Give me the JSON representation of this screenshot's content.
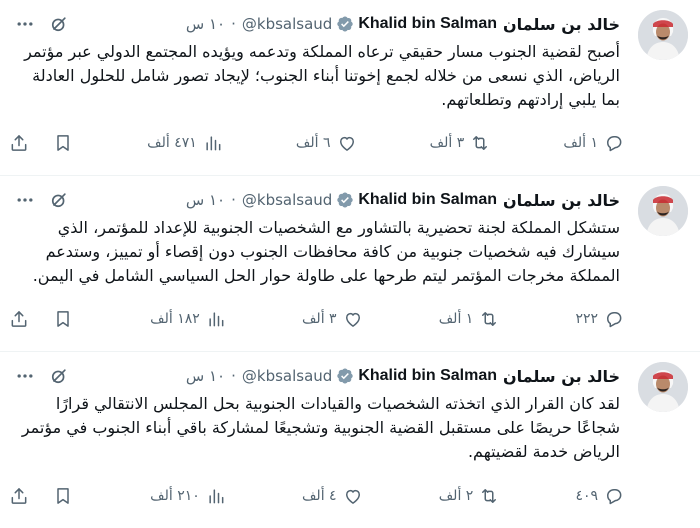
{
  "colors": {
    "text": "#0f1419",
    "muted": "#536471",
    "verified": "#829aab",
    "divider": "#eff3f4"
  },
  "icons": {
    "verified": "verified-badge-icon",
    "more": "more-options-icon",
    "grok": "grok-icon",
    "reply": "reply-icon",
    "repost": "repost-icon",
    "like": "like-icon",
    "views": "views-icon",
    "bookmark": "bookmark-icon",
    "share": "share-icon"
  },
  "tweets": [
    {
      "name_ar": "خالد بن سلمان",
      "name_en": "Khalid bin Salman",
      "handle": "@kbsalsaud",
      "dot": "·",
      "time": "١٠ س",
      "text": "أصبح لقضية الجنوب مسار حقيقي ترعاه المملكة وتدعمه ويؤيده المجتمع الدولي عبر مؤتمر الرياض، الذي نسعى من خلاله لجمع إخوتنا أبناء الجنوب؛ لإيجاد تصور شامل للحلول العادلة بما يلبي إرادتهم وتطلعاتهم.",
      "replies": "١ ألف",
      "reposts": "٣ ألف",
      "likes": "٦ ألف",
      "views": "٤٧١ ألف"
    },
    {
      "name_ar": "خالد بن سلمان",
      "name_en": "Khalid bin Salman",
      "handle": "@kbsalsaud",
      "dot": "·",
      "time": "١٠ س",
      "text": "ستشكل المملكة لجنة تحضيرية بالتشاور مع الشخصيات الجنوبية للإعداد للمؤتمر، الذي سيشارك فيه شخصيات جنوبية من كافة محافظات الجنوب دون إقصاء أو تمييز، وستدعم المملكة مخرجات المؤتمر ليتم طرحها على طاولة حوار الحل السياسي الشامل في اليمن.",
      "replies": "٢٢٢",
      "reposts": "١ ألف",
      "likes": "٣ ألف",
      "views": "١٨٢ ألف"
    },
    {
      "name_ar": "خالد بن سلمان",
      "name_en": "Khalid bin Salman",
      "handle": "@kbsalsaud",
      "dot": "·",
      "time": "١٠ س",
      "text": "لقد كان القرار الذي اتخذته الشخصيات والقيادات الجنوبية بحل المجلس الانتقالي قرارًا شجاعًا حريصًا على مستقبل القضية الجنوبية وتشجيعًا لمشاركة باقي أبناء الجنوب في مؤتمر الرياض خدمة لقضيتهم.",
      "replies": "٤٠٩",
      "reposts": "٢ ألف",
      "likes": "٤ ألف",
      "views": "٢١٠ ألف"
    }
  ]
}
